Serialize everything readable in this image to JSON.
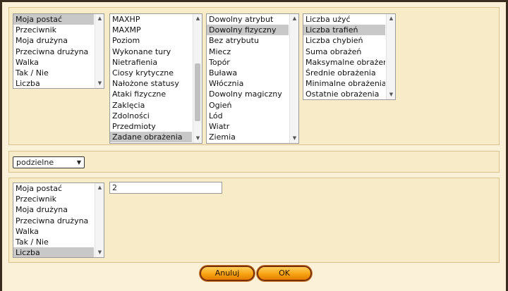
{
  "list_subject": {
    "items": [
      "Moja postać",
      "Przeciwnik",
      "Moja drużyna",
      "Przeciwna drużyna",
      "Walka",
      "Tak / Nie",
      "Liczba"
    ],
    "selected": 0
  },
  "list_stat": {
    "items": [
      "MAXHP",
      "MAXMP",
      "Poziom",
      "Wykonane tury",
      "Nietrafienia",
      "Ciosy krytyczne",
      "Nałożone statusy",
      "Ataki fizyczne",
      "Zaklęcia",
      "Zdolności",
      "Przedmioty",
      "Zadane obrażenia"
    ],
    "selected": 11
  },
  "list_attribute": {
    "items": [
      "Dowolny atrybut",
      "Dowolny fizyczny",
      "Bez atrybutu",
      "Miecz",
      "Topór",
      "Buława",
      "Włócznia",
      "Dowolny magiczny",
      "Ogień",
      "Lód",
      "Wiatr",
      "Ziemia"
    ],
    "selected": 1
  },
  "list_metric": {
    "items": [
      "Liczba użyć",
      "Liczba trafień",
      "Liczba chybień",
      "Suma obrażeń",
      "Maksymalne obrażenia",
      "Średnie obrażenia",
      "Minimalne obrażenia",
      "Ostatnie obrażenia"
    ],
    "selected": 1
  },
  "operator_select": {
    "value": "podzielne"
  },
  "list_operand": {
    "items": [
      "Moja postać",
      "Przeciwnik",
      "Moja drużyna",
      "Przeciwna drużyna",
      "Walka",
      "Tak / Nie",
      "Liczba"
    ],
    "selected": 6
  },
  "value_input": {
    "value": "2"
  },
  "buttons": {
    "cancel": "Anuluj",
    "ok": "OK"
  },
  "icons": {
    "up": "scroll-up-arrow-icon",
    "down": "scroll-down-arrow-icon",
    "caret": "dropdown-caret-icon"
  }
}
